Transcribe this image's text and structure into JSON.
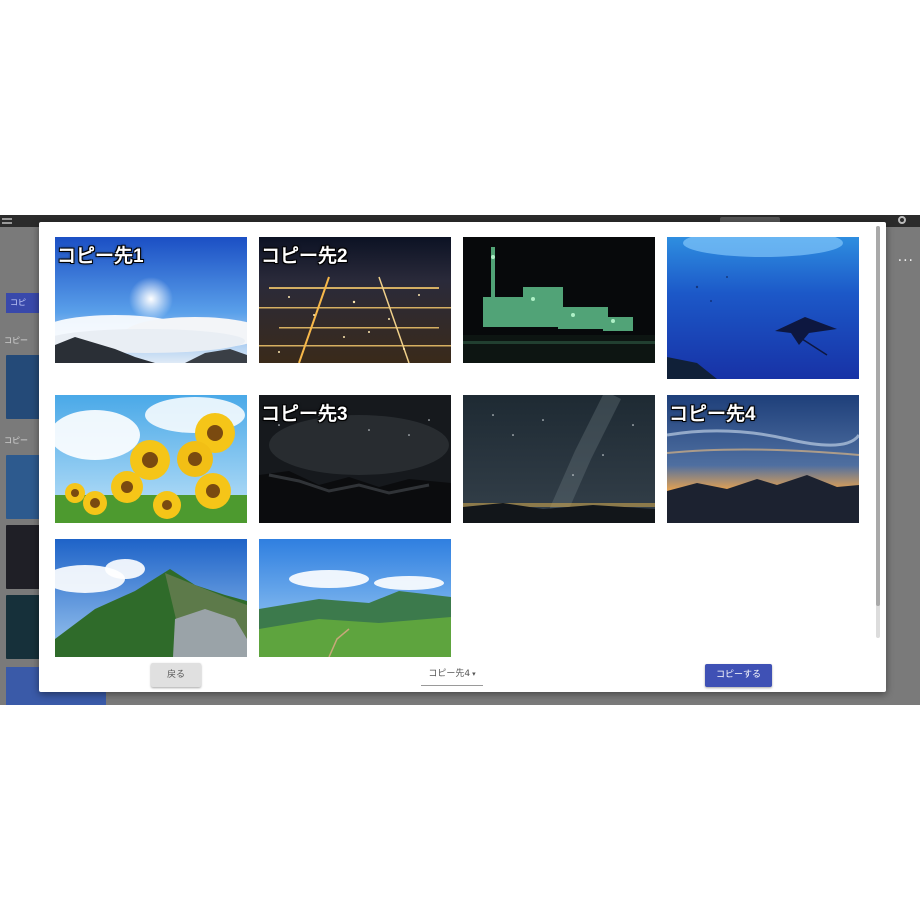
{
  "background_app": {
    "side_button_label": "コピ",
    "side_label_1": "コピー",
    "side_label_2": "コピー",
    "more_menu": "···"
  },
  "dialog": {
    "tiles": [
      {
        "caption": "コピー先1",
        "scene": "sunrise-above-clouds"
      },
      {
        "caption": "コピー先2",
        "scene": "city-night-view"
      },
      {
        "caption": "",
        "scene": "factory-night"
      },
      {
        "caption": "",
        "scene": "underwater-manta-ray"
      },
      {
        "caption": "",
        "scene": "sunflowers"
      },
      {
        "caption": "コピー先3",
        "scene": "starry-night-mountain"
      },
      {
        "caption": "",
        "scene": "milky-way"
      },
      {
        "caption": "コピー先4",
        "scene": "mountain-sunset"
      },
      {
        "caption": "",
        "scene": "rocky-mountain-ridge"
      },
      {
        "caption": "",
        "scene": "green-mountain-meadow"
      }
    ],
    "back_button": "戻る",
    "destination_select": "コピー先4",
    "copy_button": "コピーする"
  },
  "colors": {
    "primary": "#3f51b5",
    "overlay": "#7a7a7a"
  }
}
